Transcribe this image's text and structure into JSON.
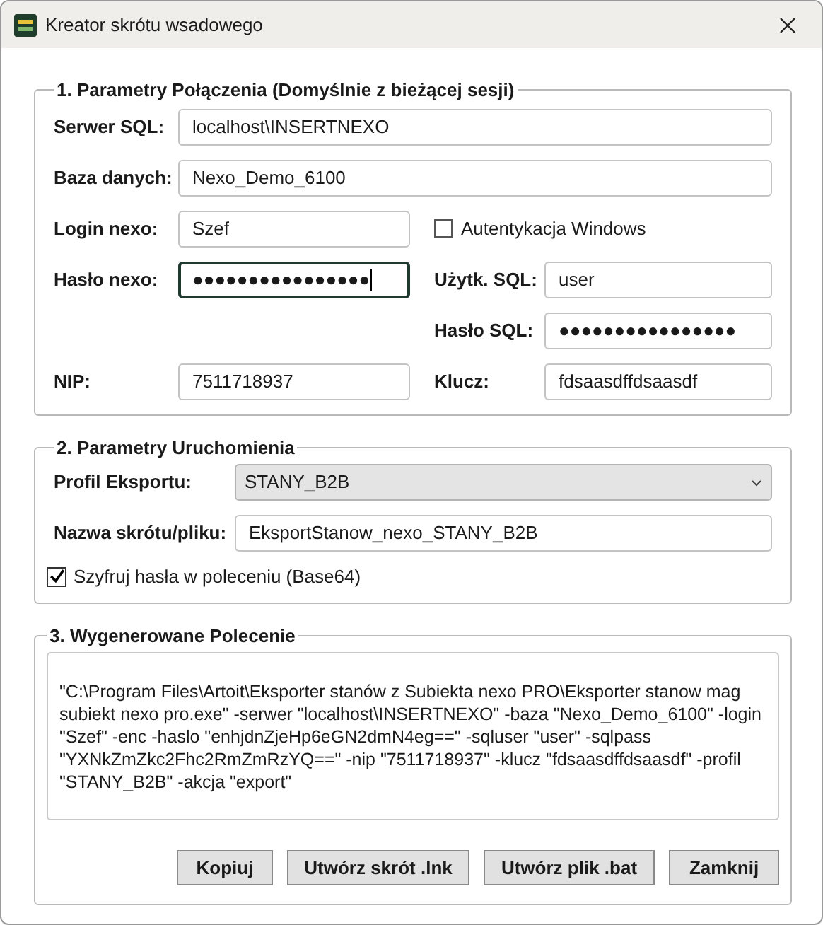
{
  "window": {
    "title": "Kreator skrótu wsadowego"
  },
  "connection": {
    "legend": "1. Parametry Połączenia (Domyślnie z bieżącej sesji)",
    "server": {
      "label": "Serwer SQL:",
      "value": "localhost\\INSERTNEXO"
    },
    "database": {
      "label": "Baza danych:",
      "value": "Nexo_Demo_6100"
    },
    "login": {
      "label": "Login nexo:",
      "value": "Szef"
    },
    "windows_auth": {
      "label": "Autentykacja Windows",
      "checked": false
    },
    "nexo_password": {
      "label": "Hasło nexo:",
      "value": "●●●●●●●●●●●●●●●●",
      "focused": true
    },
    "sql_user": {
      "label": "Użytk. SQL:",
      "value": "user"
    },
    "sql_password": {
      "label": "Hasło SQL:",
      "value": "●●●●●●●●●●●●●●●●"
    },
    "nip": {
      "label": "NIP:",
      "value": "7511718937"
    },
    "key": {
      "label": "Klucz:",
      "value": "fdsaasdffdsaasdf"
    }
  },
  "run": {
    "legend": "2. Parametry Uruchomienia",
    "profile": {
      "label": "Profil Eksportu:",
      "value": "STANY_B2B"
    },
    "name": {
      "label": "Nazwa skrótu/pliku:",
      "value": "EksportStanow_nexo_STANY_B2B"
    },
    "encrypt": {
      "label": "Szyfruj hasła w poleceniu (Base64)",
      "checked": true
    }
  },
  "command": {
    "legend": "3. Wygenerowane Polecenie",
    "text": "\"C:\\Program Files\\Artoit\\Eksporter stanów z Subiekta nexo PRO\\Eksporter stanow mag subiekt nexo pro.exe\" -serwer \"localhost\\INSERTNEXO\" -baza \"Nexo_Demo_6100\" -login \"Szef\" -enc -haslo \"enhjdnZjeHp6eGN2dmN4eg==\" -sqluser \"user\" -sqlpass \"YXNkZmZkc2Fhc2RmZmRzYQ==\" -nip \"7511718937\" -klucz \"fdsaasdffdsaasdf\" -profil \"STANY_B2B\" -akcja \"export\"",
    "buttons": [
      "Kopiuj",
      "Utwórz skrót .lnk",
      "Utwórz plik .bat",
      "Zamknij"
    ]
  }
}
